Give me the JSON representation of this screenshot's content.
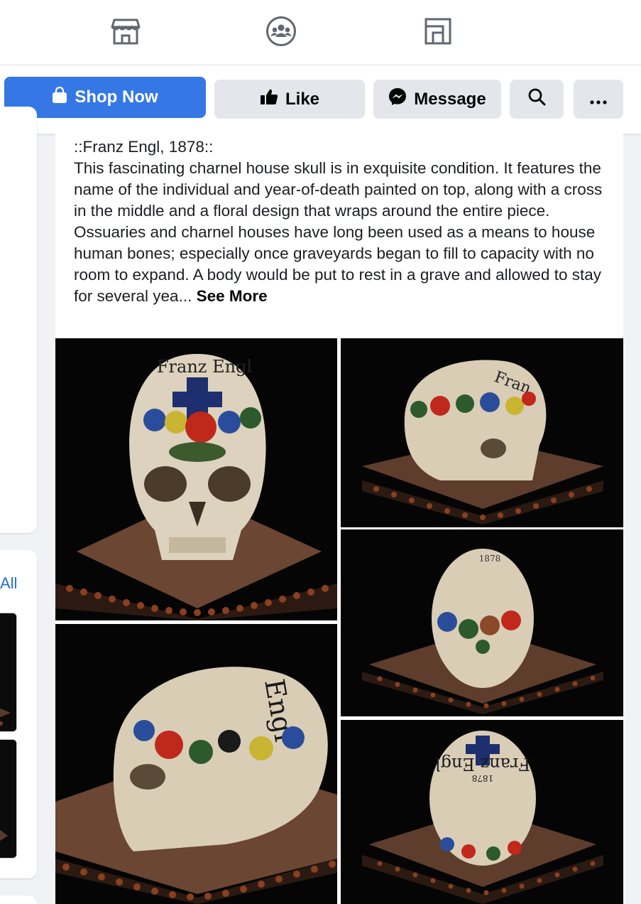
{
  "nav": {
    "icons": [
      "shop-icon",
      "groups-icon",
      "pages-icon"
    ]
  },
  "actions": {
    "shop_now": "Shop Now",
    "like": "Like",
    "message": "Message"
  },
  "sidebar": {
    "see_all_fragment": "All"
  },
  "post": {
    "title_line": "::Franz Engl, 1878::",
    "body": "This fascinating charnel house skull is in exquisite condition. It features the name of the individual and year-of-death painted on top, along with a cross in the middle and a floral design that wraps around the entire piece. Ossuaries and charnel houses have long been used as a means to house human bones; especially once graveyards began to fill to capacity with no room to expand. A body would be put to rest in a grave and allowed to stay for several yea...",
    "see_more": "See More"
  },
  "photos": [
    {
      "name": "skull-front-photo"
    },
    {
      "name": "skull-side-right-photo"
    },
    {
      "name": "skull-back-photo"
    },
    {
      "name": "skull-side-left-photo"
    },
    {
      "name": "skull-top-photo"
    }
  ],
  "colors": {
    "primary": "#3578e5",
    "secondary_btn": "#e4e6eb",
    "link": "#216fdb"
  }
}
